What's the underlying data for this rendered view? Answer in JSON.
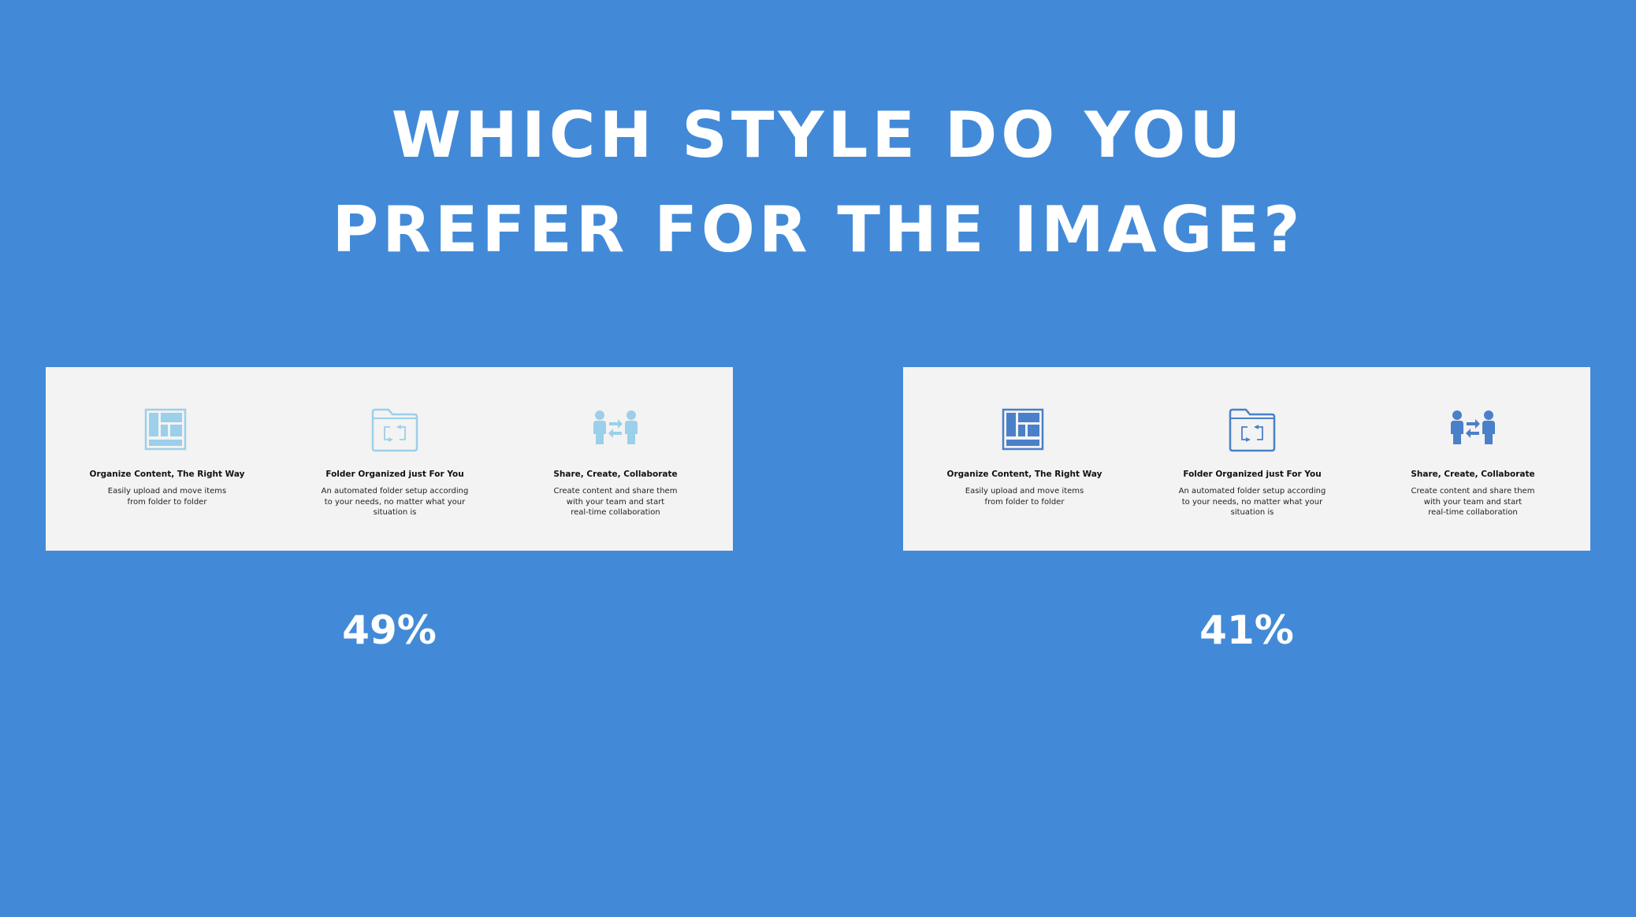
{
  "question": {
    "line1": "WHICH STYLE DO YOU",
    "line2": "PREFER FOR THE IMAGE?"
  },
  "colors": {
    "background": "#428ad8",
    "card": "#f3f3f3",
    "option_a_icon": "#9ccfe9",
    "option_b_icon": "#4a80c9"
  },
  "options": [
    {
      "percent": "49%",
      "icon_style": "light-blue",
      "features": [
        {
          "icon": "layout-grid-icon",
          "title": "Organize Content, The Right Way",
          "description": "Easily upload and move items\nfrom folder to folder"
        },
        {
          "icon": "folder-sync-icon",
          "title": "Folder Organized just For You",
          "description": "An automated folder setup according\nto your needs, no matter what your\nsituation is"
        },
        {
          "icon": "people-exchange-icon",
          "title": "Share, Create, Collaborate",
          "description": "Create content and share them\nwith your team and start\nreal-time collaboration"
        }
      ]
    },
    {
      "percent": "41%",
      "icon_style": "dark-blue",
      "features": [
        {
          "icon": "layout-grid-icon",
          "title": "Organize Content, The Right Way",
          "description": "Easily upload and move items\nfrom folder to folder"
        },
        {
          "icon": "folder-sync-icon",
          "title": "Folder Organized just For You",
          "description": "An automated folder setup according\nto your needs, no matter what your\nsituation is"
        },
        {
          "icon": "people-exchange-icon",
          "title": "Share, Create, Collaborate",
          "description": "Create content and share them\nwith your team and start\nreal-time collaboration"
        }
      ]
    }
  ]
}
